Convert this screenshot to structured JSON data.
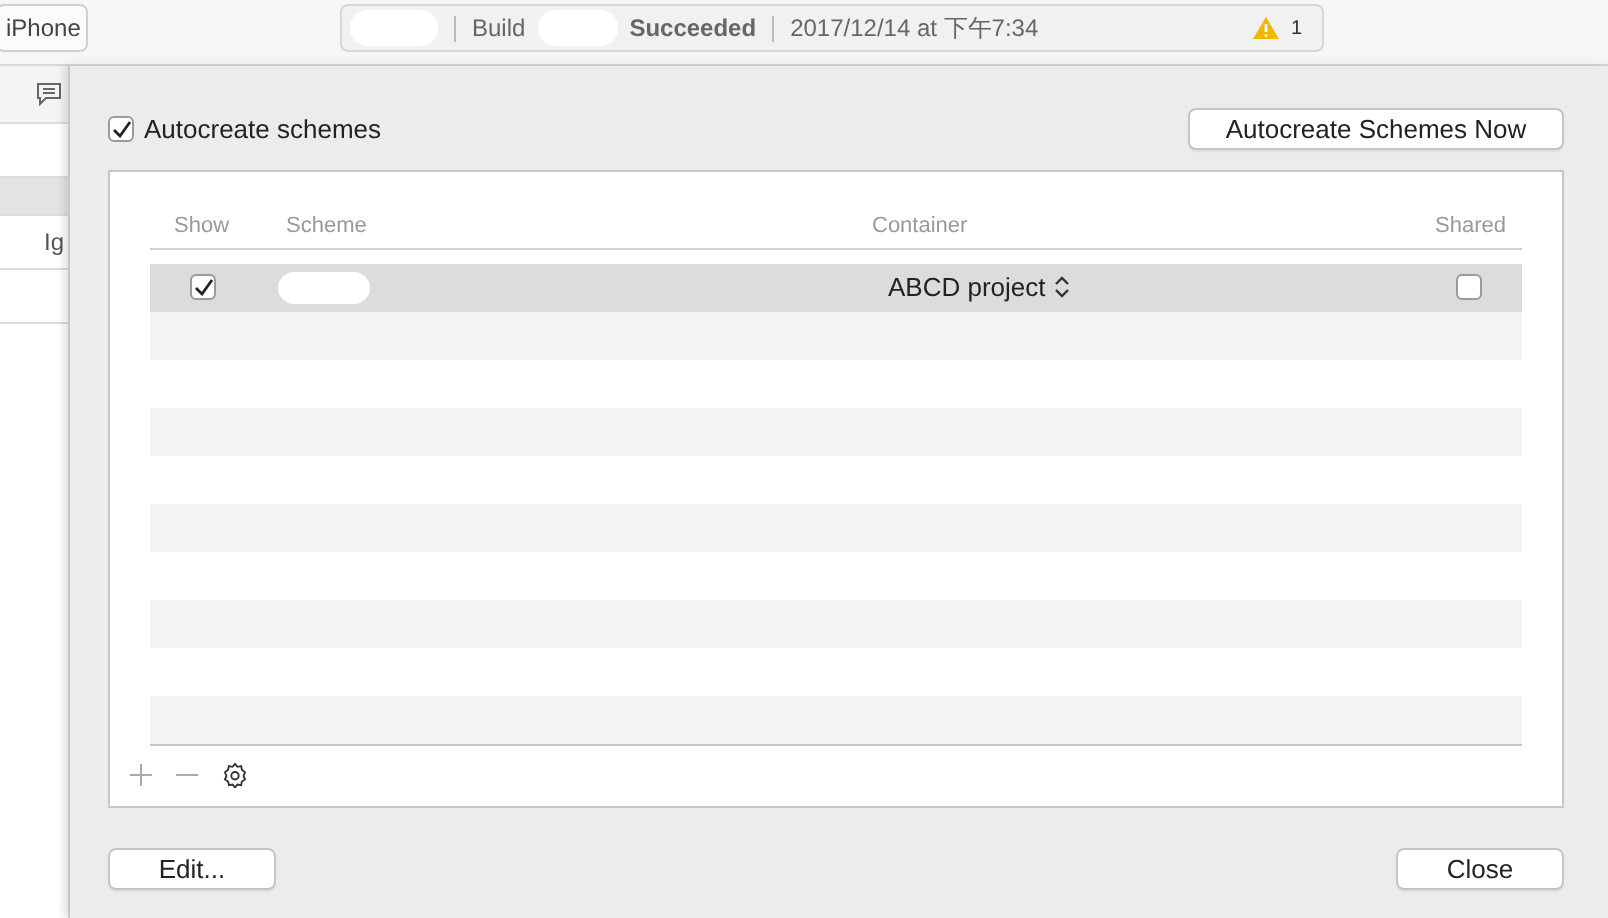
{
  "toolbar": {
    "device": "iPhone",
    "activity": {
      "action": "Build",
      "status": "Succeeded",
      "timestamp": "2017/12/14 at 下午7:34",
      "warning_count": "1"
    }
  },
  "background_sidebar": {
    "item_label": "Ig"
  },
  "sheet": {
    "autocreate": {
      "label": "Autocreate schemes",
      "checked": true
    },
    "autocreate_now_button": "Autocreate Schemes Now",
    "table": {
      "columns": [
        "Show",
        "Scheme",
        "Container",
        "Shared"
      ],
      "rows": [
        {
          "show": true,
          "container": "ABCD project",
          "shared": false,
          "selected": true
        }
      ]
    },
    "buttons": [
      "Edit...",
      "Close"
    ]
  }
}
